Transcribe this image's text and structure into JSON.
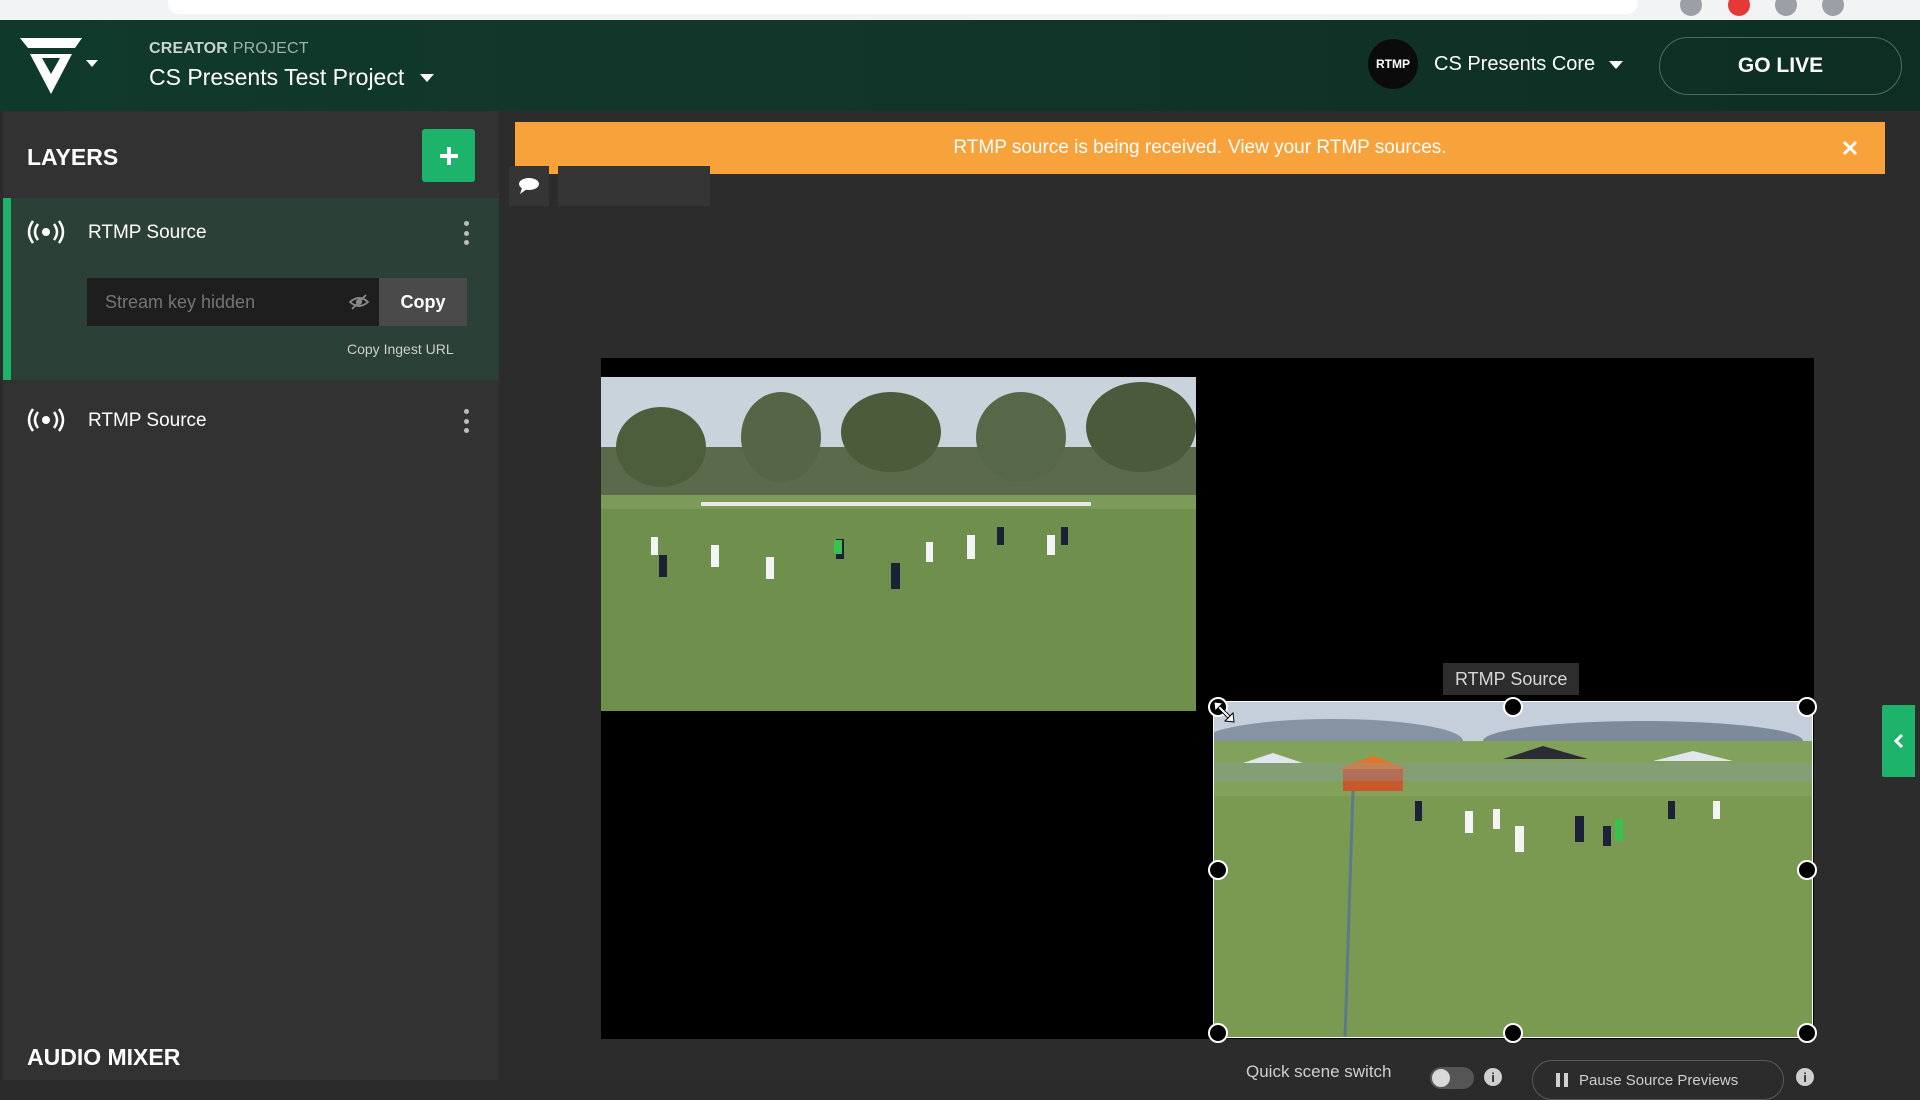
{
  "browser": {
    "url": ""
  },
  "header": {
    "project_kicker_bold": "CREATOR",
    "project_kicker_rest": "PROJECT",
    "project_name": "CS Presents Test Project",
    "rtmp_badge": "RTMP",
    "core_name": "CS Presents Core",
    "go_live_label": "GO LIVE"
  },
  "sidebar": {
    "title": "LAYERS",
    "layers": [
      {
        "label": "RTMP Source",
        "stream_key_placeholder": "Stream key hidden",
        "copy_label": "Copy",
        "copy_ingest_label": "Copy Ingest URL"
      },
      {
        "label": "RTMP Source"
      }
    ],
    "audio_title": "AUDIO MIXER"
  },
  "banner": {
    "message": "RTMP source is being received.",
    "link_text": "View your RTMP sources.",
    "color": "#f7a23b"
  },
  "stage": {
    "selected_source_label": "RTMP Source"
  },
  "footer": {
    "quick_scene_label": "Quick scene switch",
    "pause_label": "Pause Source Previews",
    "info_glyph": "i"
  },
  "colors": {
    "accent": "#1db36b",
    "header_bg": "#0f3a2b",
    "sidebar_bg": "#323232"
  }
}
